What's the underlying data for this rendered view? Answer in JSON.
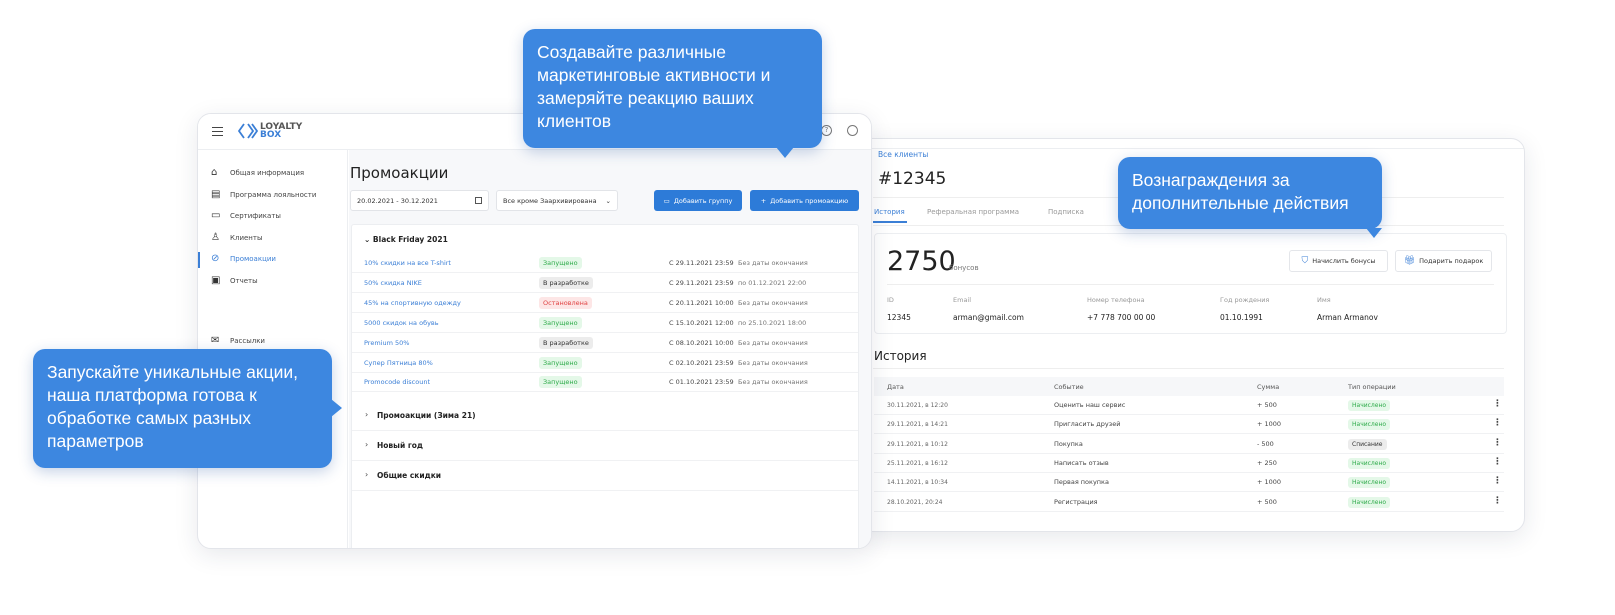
{
  "callouts": {
    "top": "Создавайте различные маркетинговые активности и замеряйте реакцию ваших клиентов",
    "left": "Запускайте уникальные акции, наша платформа готова к обработке самых разных параметров",
    "right": "Вознаграждения за дополнительные действия"
  },
  "promo_app": {
    "logo_line1": "LOYALTY",
    "logo_line2": "BOX",
    "sidebar": [
      {
        "label": "Общая информация",
        "icon": "home-icon"
      },
      {
        "label": "Программа лояльности",
        "icon": "card-icon"
      },
      {
        "label": "Сертификаты",
        "icon": "certificate-icon"
      },
      {
        "label": "Клиенты",
        "icon": "user-icon"
      },
      {
        "label": "Промоакции",
        "icon": "promo-icon",
        "active": true
      },
      {
        "label": "Отчеты",
        "icon": "report-icon"
      },
      {
        "label": "Рассылки",
        "icon": "mail-icon"
      }
    ],
    "title": "Промоакции",
    "date_range": "20.02.2021 - 30.12.2021",
    "filter": "Все кроме Заархивирована",
    "add_group": "Добавить группу",
    "add_promo": "Добавить промоакцию",
    "open_group": "Black Friday 2021",
    "rows": [
      {
        "name": "10% скидки на все T-shirt",
        "status": "Запущено",
        "kind": "g",
        "start": "С 29.11.2021 23:59",
        "end": "Без даты окончания"
      },
      {
        "name": "50% скидка NIKE",
        "status": "В разработке",
        "kind": "gr",
        "start": "С 29.11.2021 23:59",
        "end": "по 01.12.2021 22:00"
      },
      {
        "name": "45% на спортивную одежду",
        "status": "Остановлена",
        "kind": "r",
        "start": "С 20.11.2021 10:00",
        "end": "Без даты окончания"
      },
      {
        "name": "5000 скидок на обувь",
        "status": "Запущено",
        "kind": "g",
        "start": "С 15.10.2021 12:00",
        "end": "по 25.10.2021 18:00"
      },
      {
        "name": "Premium 50%",
        "status": "В разработке",
        "kind": "gr",
        "start": "С 08.10.2021 10:00",
        "end": "Без даты окончания"
      },
      {
        "name": "Супер Пятница 80%",
        "status": "Запущено",
        "kind": "g",
        "start": "С 02.10.2021 23:59",
        "end": "Без даты окончания"
      },
      {
        "name": "Promocode discount",
        "status": "Запущено",
        "kind": "g",
        "start": "С 01.10.2021 23:59",
        "end": "Без даты окончания"
      }
    ],
    "groups": [
      "Промоакции (Зима 21)",
      "Новый год",
      "Общие скидки"
    ]
  },
  "client_app": {
    "breadcrumb": "Все клиенты",
    "title": "#12345",
    "tabs": [
      "История",
      "Реферальная программа",
      "Подписка"
    ],
    "bonus": "2750",
    "bonus_unit": "бонусов",
    "accrue_btn": "Начислить бонусы",
    "gift_btn": "Подарить подарок",
    "info": [
      {
        "label": "ID",
        "value": "12345"
      },
      {
        "label": "Email",
        "value": "arman@gmail.com"
      },
      {
        "label": "Номер телефона",
        "value": "+7 778 700 00 00"
      },
      {
        "label": "Год рождения",
        "value": "01.10.1991"
      },
      {
        "label": "Имя",
        "value": "Arman Armanov"
      }
    ],
    "history_title": "История",
    "columns": [
      "Дата",
      "Событие",
      "Сумма",
      "Тип операции"
    ],
    "history": [
      {
        "date": "30.11.2021, в 12:20",
        "event": "Оценить наш сервис",
        "sum": "+ 500",
        "type": "Начислено",
        "kind": "g"
      },
      {
        "date": "29.11.2021, в 14:21",
        "event": "Пригласить друзей",
        "sum": "+ 1000",
        "type": "Начислено",
        "kind": "g"
      },
      {
        "date": "29.11.2021, в 10:12",
        "event": "Покупка",
        "sum": "- 500",
        "type": "Списание",
        "kind": "gr"
      },
      {
        "date": "25.11.2021, в 16:12",
        "event": "Написать отзыв",
        "sum": "+ 250",
        "type": "Начислено",
        "kind": "g"
      },
      {
        "date": "14.11.2021, в 10:34",
        "event": "Первая покупка",
        "sum": "+ 1000",
        "type": "Начислено",
        "kind": "g"
      },
      {
        "date": "28.10.2021, 20:24",
        "event": "Регистрация",
        "sum": "+ 500",
        "type": "Начислено",
        "kind": "g"
      }
    ]
  },
  "colors": {
    "accent": "#3d87e0",
    "success": "#2eab4a",
    "danger": "#e04444"
  }
}
